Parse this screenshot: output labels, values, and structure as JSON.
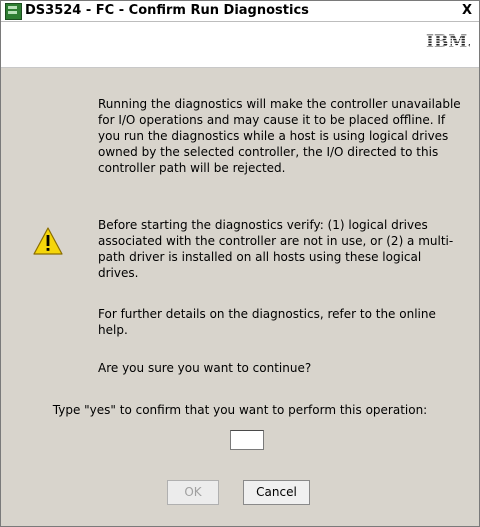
{
  "window": {
    "title": "DS3524 - FC - Confirm Run Diagnostics",
    "close_glyph": "X"
  },
  "banner": {
    "logo_text": "IBM.",
    "logo_icon": "ibm-logo"
  },
  "message": {
    "paragraphs": [
      "Running the diagnostics will make the controller unavailable for I/O operations and may cause it to be placed offline. If you run the diagnostics while a host is using logical drives owned by the selected controller, the I/O directed to this controller path will be rejected.",
      "Before starting the diagnostics verify: (1) logical drives associated with the controller are not in use, or (2) a multi-path driver is installed on all hosts using these logical drives.",
      "For further details on the diagnostics, refer to the online help.",
      "Are you sure you want to continue?"
    ],
    "icon": "warning-icon"
  },
  "confirm": {
    "prompt": "Type \"yes\" to confirm that you want to perform this operation:",
    "value": ""
  },
  "buttons": {
    "ok_label": "OK",
    "cancel_label": "Cancel",
    "ok_enabled": false
  },
  "colors": {
    "dialog_bg": "#d8d4cc",
    "banner_bg": "#ffffff",
    "warning_yellow": "#f5d60a"
  }
}
